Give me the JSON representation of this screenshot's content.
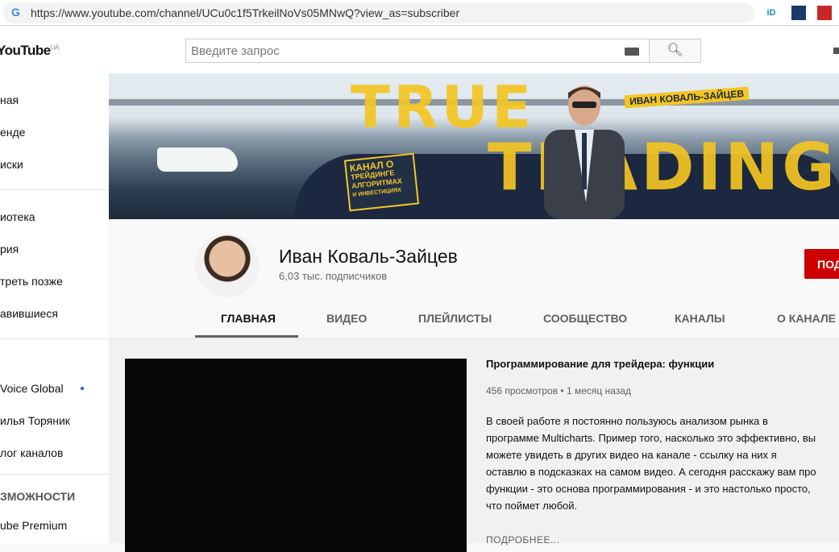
{
  "browser": {
    "url": "https://www.youtube.com/channel/UCu0c1f5TrkeilNoVs05MNwQ?view_as=subscriber",
    "extensions": [
      "iD",
      "stats-icon",
      "save-icon"
    ]
  },
  "header": {
    "logo": "YouTube",
    "region": "UA",
    "search_placeholder": "Введите запрос"
  },
  "sidebar": {
    "items": [
      "ная",
      "енде",
      "иски",
      "иотека",
      "рия",
      "треть позже",
      "авившиеся"
    ],
    "subscriptions": [
      "Voice Global",
      "илья Торяник",
      "лог каналов"
    ],
    "section_heading": "ЗМОЖНОСТИ",
    "extra": [
      "ube Premium"
    ]
  },
  "banner": {
    "title1": "TRUE",
    "title2": "TRADING",
    "name": "ИВАН КОВАЛЬ-ЗАЙЦЕВ",
    "box": [
      "КАНАЛ О",
      "ТРЕЙДИНГЕ",
      "АЛГОРИТМАХ",
      "И ИНВЕСТИЦИЯХ"
    ]
  },
  "channel": {
    "name": "Иван Коваль-Зайцев",
    "subscribers": "6,03 тыс. подписчиков",
    "subscribe_label": "ПОД"
  },
  "tabs": [
    "ГЛАВНАЯ",
    "ВИДЕО",
    "ПЛЕЙЛИСТЫ",
    "СООБЩЕСТВО",
    "КАНАЛЫ",
    "О КАНАЛЕ"
  ],
  "featured": {
    "title": "Программирование для трейдера: функции",
    "meta": "456 просмотров • 1 месяц назад",
    "description": "В своей работе я постоянно пользуюсь анализом рынка в программе Multicharts. Пример того, насколько это эффективно, вы можете увидеть в других видео на канале - ссылку на них я оставлю в подсказках на самом видео. А сегодня расскажу вам про функции - это основа программирования - и это настолько просто, что поймет любой.",
    "more": "ПОДРОБНЕЕ..."
  }
}
